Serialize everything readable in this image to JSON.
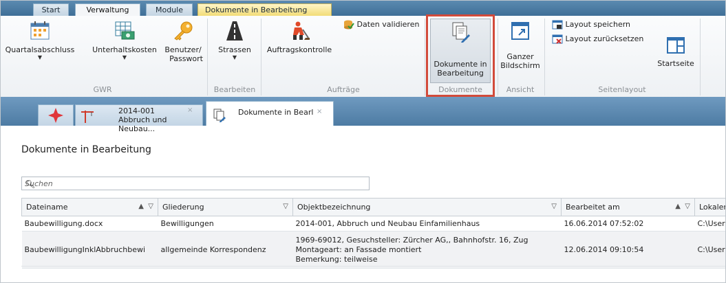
{
  "ribbon_tabs": [
    {
      "label": "Start"
    },
    {
      "label": "Verwaltung"
    },
    {
      "label": "Module"
    },
    {
      "label": "Dokumente in Bearbeitung"
    }
  ],
  "ribbon": {
    "gwr": {
      "group_label": "GWR",
      "quartal": "Quartalsabschluss",
      "unterhalt": "Unterhaltskosten",
      "benutzer_line1": "Benutzer/",
      "benutzer_line2": "Passwort"
    },
    "bearbeiten": {
      "group_label": "Bearbeiten",
      "strassen": "Strassen"
    },
    "auftraege": {
      "group_label": "Aufträge",
      "auftragskontrolle": "Auftragskontrolle",
      "daten_validieren": "Daten validieren"
    },
    "dokumente": {
      "group_label": "Dokumente",
      "line1": "Dokumente in",
      "line2": "Bearbeitung"
    },
    "ansicht": {
      "group_label": "Ansicht",
      "line1": "Ganzer",
      "line2": "Bildschirm"
    },
    "seitenlayout": {
      "group_label": "Seitenlayout",
      "layout_speichern": "Layout speichern",
      "layout_zuruecksetzen": "Layout zurücksetzen",
      "startseite": "Startseite"
    }
  },
  "doc_tabs": {
    "item_line1": "2014-001",
    "item_line2": "Abbruch und Neubau...",
    "active_label": "Dokumente in Bearl",
    "close": "×"
  },
  "page": {
    "title": "Dokumente in Bearbeitung",
    "search_placeholder": "Suchen"
  },
  "table": {
    "columns": [
      "Dateiname",
      "Gliederung",
      "Objektbezeichnung",
      "Bearbeitet am",
      "Lokaler"
    ],
    "rows": [
      {
        "dateiname": "Baubewilligung.docx",
        "gliederung": "Bewilligungen",
        "objekt": [
          "2014-001, Abbruch und Neubau Einfamilienhaus"
        ],
        "bearbeitet": "16.06.2014 07:52:02",
        "lokal": "C:\\User"
      },
      {
        "dateiname": "BaubewilligungInklAbbruchbewi",
        "gliederung": "allgemeinde Korrespondenz",
        "objekt": [
          "1969-69012, Gesuchsteller: Zürcher AG,, Bahnhofstr. 16, Zug",
          "Montageart: an Fassade montiert",
          "Bemerkung: teilweise"
        ],
        "bearbeitet": "12.06.2014 09:10:54",
        "lokal": "C:\\User"
      }
    ]
  },
  "colors": {
    "highlight": "#d24a3a",
    "ribbon_bar": "#4d7ba3",
    "context_tab": "#f2dc77"
  }
}
